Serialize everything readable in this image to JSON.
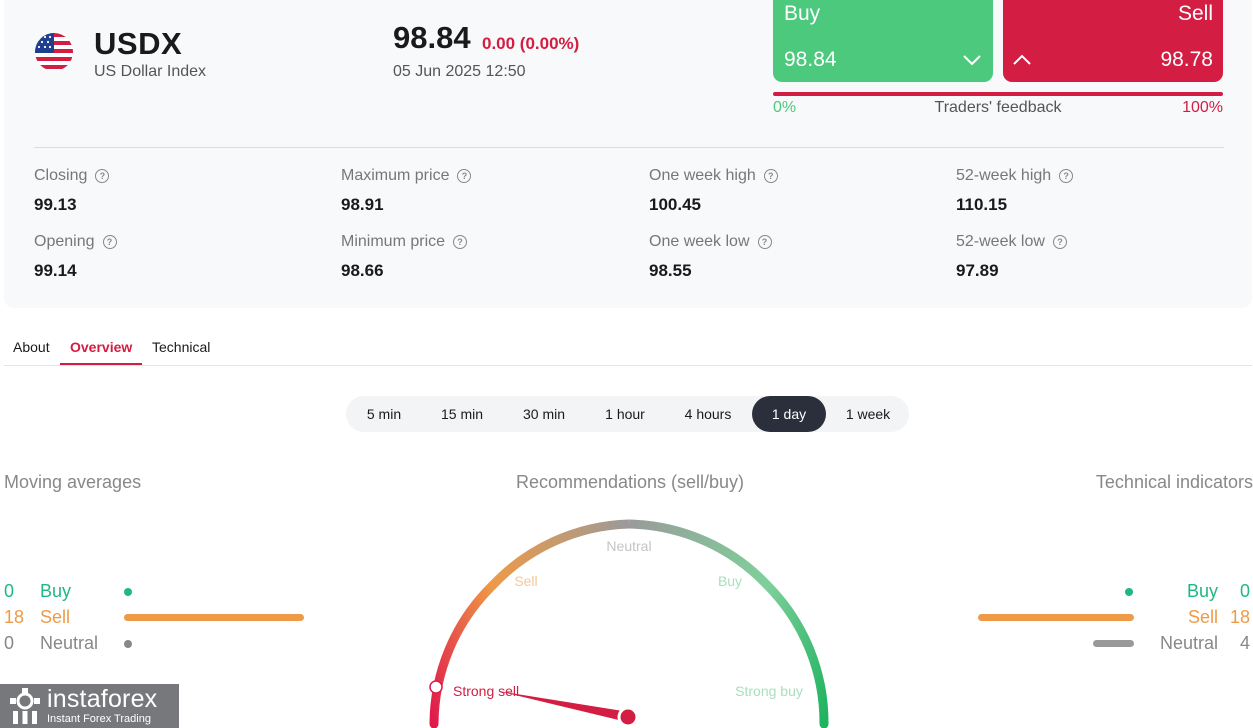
{
  "instrument": {
    "symbol": "USDX",
    "name": "US Dollar Index",
    "price": "98.84",
    "change": "0.00 (0.00%)",
    "datetime": "05 Jun 2025 12:50",
    "flag_icon": "us-flag-icon"
  },
  "trade": {
    "buy_label": "Buy",
    "buy_price": "98.84",
    "sell_label": "Sell",
    "sell_price": "98.78",
    "buy_color": "#4dc97e",
    "sell_color": "#d31d43"
  },
  "feedback": {
    "left": "0%",
    "label": "Traders' feedback",
    "right": "100%",
    "buy_fraction": 0
  },
  "stats": {
    "closing": {
      "label": "Closing",
      "value": "99.13"
    },
    "opening": {
      "label": "Opening",
      "value": "99.14"
    },
    "max_price": {
      "label": "Maximum price",
      "value": "98.91"
    },
    "min_price": {
      "label": "Minimum price",
      "value": "98.66"
    },
    "week_high": {
      "label": "One week high",
      "value": "100.45"
    },
    "week_low": {
      "label": "One week low",
      "value": "98.55"
    },
    "high_52": {
      "label": "52-week high",
      "value": "110.15"
    },
    "low_52": {
      "label": "52-week low",
      "value": "97.89"
    }
  },
  "tabs": [
    {
      "label": "About",
      "active": false
    },
    {
      "label": "Overview",
      "active": true
    },
    {
      "label": "Technical",
      "active": false
    }
  ],
  "periods": [
    {
      "label": "5 min",
      "active": false
    },
    {
      "label": "15 min",
      "active": false
    },
    {
      "label": "30 min",
      "active": false
    },
    {
      "label": "1 hour",
      "active": false
    },
    {
      "label": "4 hours",
      "active": false
    },
    {
      "label": "1 day",
      "active": true
    },
    {
      "label": "1 week",
      "active": false
    }
  ],
  "moving_averages": {
    "title": "Moving averages",
    "buy": {
      "count": "0",
      "label": "Buy"
    },
    "sell": {
      "count": "18",
      "label": "Sell"
    },
    "neutral": {
      "count": "0",
      "label": "Neutral"
    }
  },
  "recommendations": {
    "title": "Recommendations (sell/buy)",
    "labels": {
      "strong_sell": "Strong sell",
      "sell": "Sell",
      "neutral": "Neutral",
      "buy": "Buy",
      "strong_buy": "Strong buy"
    },
    "needle": "Strong sell"
  },
  "technical_indicators": {
    "title": "Technical indicators",
    "buy": {
      "count": "0",
      "label": "Buy"
    },
    "sell": {
      "count": "18",
      "label": "Sell"
    },
    "neutral": {
      "count": "4",
      "label": "Neutral"
    }
  },
  "colors": {
    "accent": "#d31d43",
    "buy": "#1fb980",
    "sell": "#ee9a47",
    "neutral": "#888888"
  },
  "logo": {
    "name": "instaforex",
    "tagline": "Instant Forex Trading"
  }
}
